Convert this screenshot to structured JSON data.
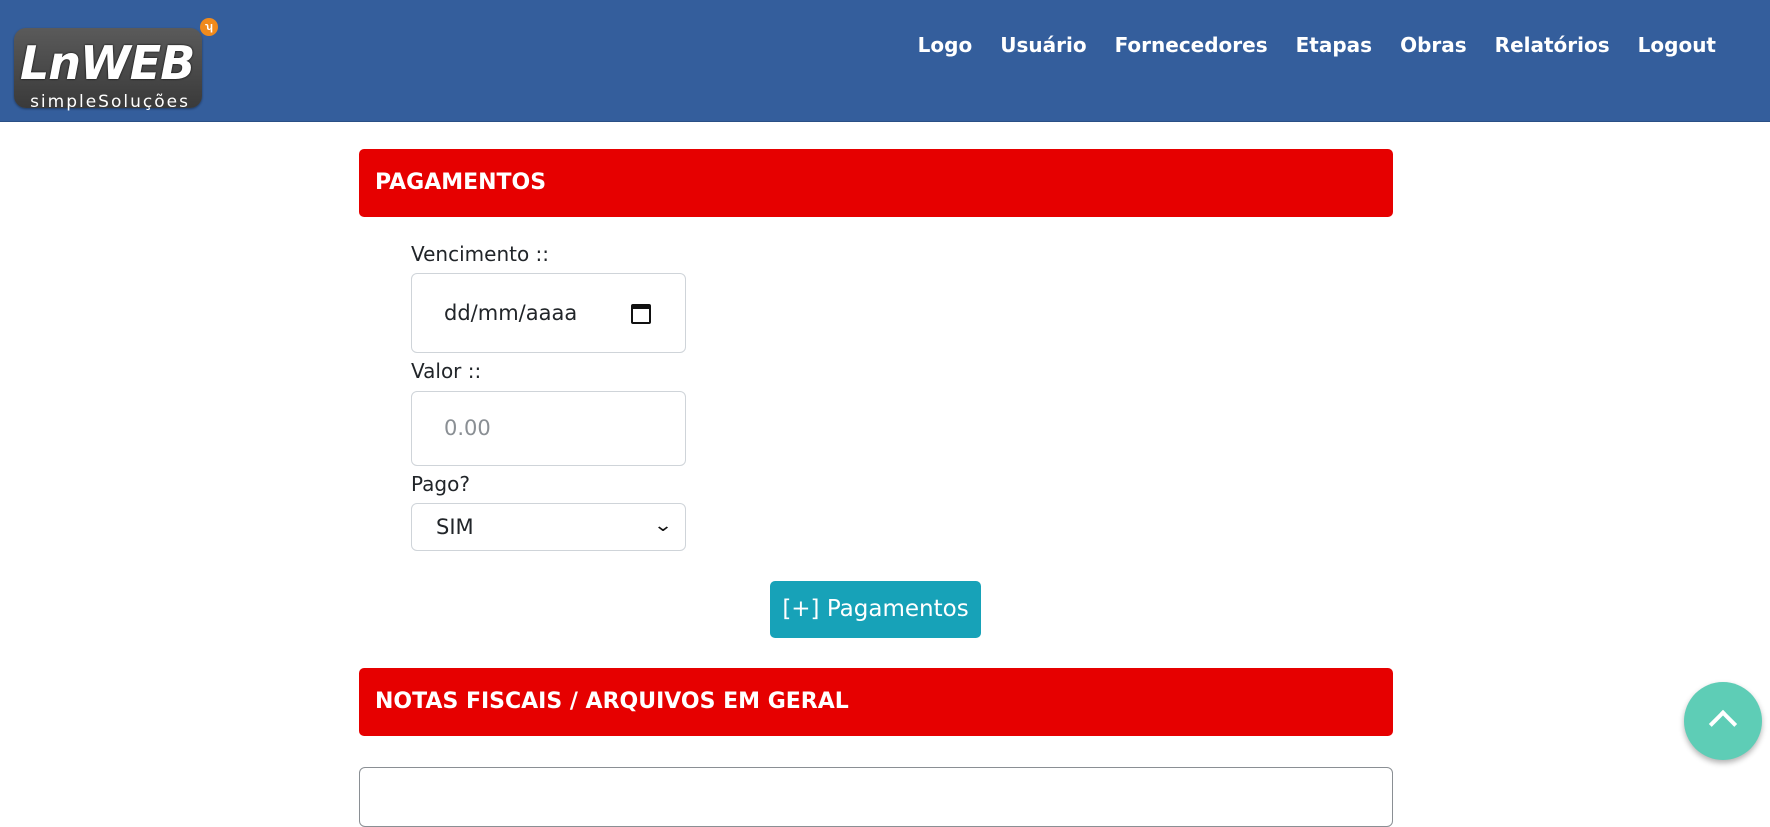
{
  "brand": {
    "logo_text": "LnWEB",
    "tagline": "simpleSoluções",
    "badge_glyph": "ʮ"
  },
  "nav": {
    "items": [
      {
        "label": "Logo"
      },
      {
        "label": "Usuário"
      },
      {
        "label": "Fornecedores"
      },
      {
        "label": "Etapas"
      },
      {
        "label": "Obras"
      },
      {
        "label": "Relatórios"
      },
      {
        "label": "Logout"
      }
    ]
  },
  "pagamentos": {
    "header": "PAGAMENTOS",
    "vencimento": {
      "label": "Vencimento ::",
      "placeholder": "dd/mm/aaaa"
    },
    "valor": {
      "label": "Valor ::",
      "placeholder": "0.00"
    },
    "pago": {
      "label": "Pago?",
      "selected": "SIM"
    },
    "add_button": "[+] Pagamentos"
  },
  "notas": {
    "header": "NOTAS FISCAIS / ARQUIVOS EM GERAL"
  },
  "colors": {
    "navbar": "#345e9c",
    "section_header": "#e60000",
    "button": "#17a2b8",
    "scroll_top": "#5ecdb6"
  }
}
